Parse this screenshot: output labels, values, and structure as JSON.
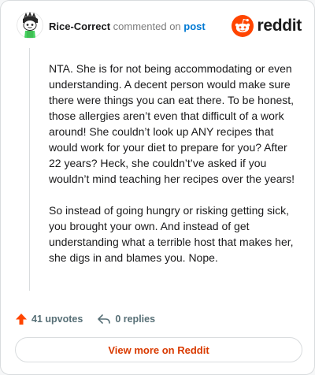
{
  "header": {
    "username": "Rice-Correct",
    "action_text": "commented on",
    "post_link": "post",
    "brand_name": "reddit"
  },
  "comment": {
    "paragraphs": [
      "NTA. She is for not being accommodating or even understanding. A decent person would make sure there were things you can eat there. To be honest, those allergies aren’t even that difficult of a work around! She couldn’t look up ANY recipes that would work for your diet to prepare for you? After 22 years? Heck, she couldn’t’ve asked if you wouldn’t mind teaching her recipes over the years!",
      "So instead of going hungry or risking getting sick, you brought your own. And instead of get understanding what a terrible host that makes her, she digs in and blames you. Nope."
    ]
  },
  "footer": {
    "upvotes": "41 upvotes",
    "replies": "0 replies"
  },
  "cta": {
    "label": "View more on Reddit"
  },
  "colors": {
    "brand_orange": "#ff4500",
    "link_blue": "#0079d3",
    "cta_text": "#d93a00",
    "muted": "#576f76"
  },
  "icons": {
    "avatar": "snoo-avatar",
    "brand": "reddit-logo-icon",
    "upvote": "upvote-arrow-icon",
    "reply": "reply-arrow-icon"
  }
}
